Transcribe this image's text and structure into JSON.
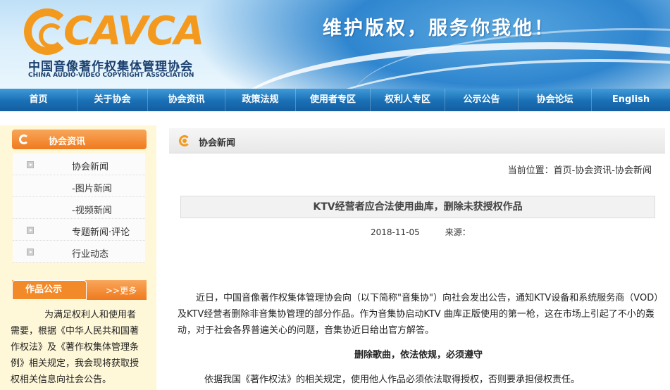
{
  "header": {
    "logo_word": "CAVCA",
    "logo_cn": "中国音像著作权集体管理协会",
    "logo_en": "CHINA AUDIO-VIDEO COPYRIGHT ASSOCIATION",
    "slogan": "维护版权，服务你我他！"
  },
  "nav": {
    "items": [
      {
        "label": "首页"
      },
      {
        "label": "关于协会"
      },
      {
        "label": "协会资讯"
      },
      {
        "label": "政策法规"
      },
      {
        "label": "使用者专区"
      },
      {
        "label": "权利人专区"
      },
      {
        "label": "公示公告"
      },
      {
        "label": "协会论坛"
      },
      {
        "label": "English"
      }
    ]
  },
  "sidebar": {
    "title": "协会资讯",
    "items": [
      {
        "label": "协会新闻"
      },
      {
        "label": "-图片新闻"
      },
      {
        "label": "-视频新闻"
      },
      {
        "label": "专题新闻·评论"
      },
      {
        "label": "行业动态"
      }
    ]
  },
  "notice": {
    "tab_label": "作品公示",
    "more_label": ">>更多",
    "body": "为满足权利人和使用者需要，根据《中华人民共和国著作权法》及《著作权集体管理条例》相关规定，我会现将获取授权相关信息向社会公告。"
  },
  "main": {
    "section_title": "协会新闻",
    "breadcrumb_prefix": "当前位置：",
    "breadcrumb_path": "首页-协会资讯-协会新闻",
    "article_title": "KTV经营者应合法使用曲库，删除未获授权作品",
    "date": "2018-11-05",
    "source_label": "来源：",
    "paragraph1": "近日，中国音像著作权集体管理协会向（以下简称\"音集协\"）向社会发出公告，通知KTV设备和系统服务商（VOD）及KTV经营者删除非音集协管理的部分作品。作为音集协启动KTV 曲库正版使用的第一枪，这在市场上引起了不小的轰动，对于社会各界普遍关心的问题，音集协近日给出官方解答。",
    "subtitle": "删除歌曲，依法依规，必须遵守",
    "paragraph2": "依据我国《著作权法》的相关规定，使用他人作品必须依法取得授权，否则要承担侵权责任。"
  },
  "colors": {
    "nav_blue": "#1a6fb5",
    "accent_orange": "#ef7a1e"
  }
}
